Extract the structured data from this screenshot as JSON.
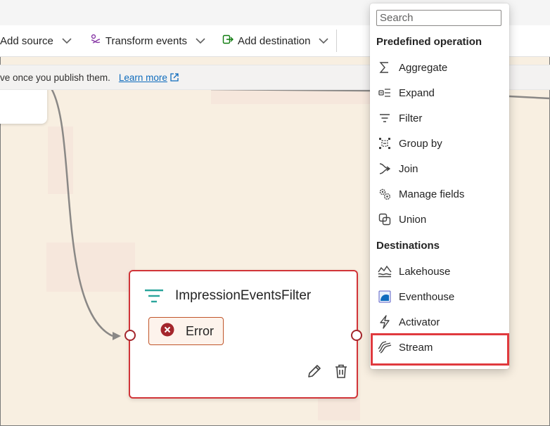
{
  "toolbar": {
    "add_source": "Add source",
    "transform_events": "Transform events",
    "add_destination": "Add destination"
  },
  "infobar": {
    "text": "ve once you publish them.",
    "learn_more": "Learn more"
  },
  "node": {
    "title": "ImpressionEventsFilter",
    "status": "Error"
  },
  "menu": {
    "search_placeholder": "Search",
    "sections": [
      {
        "title": "Predefined operation",
        "items": [
          {
            "label": "Aggregate",
            "icon": "sigma-icon"
          },
          {
            "label": "Expand",
            "icon": "expand-icon"
          },
          {
            "label": "Filter",
            "icon": "filter-icon"
          },
          {
            "label": "Group by",
            "icon": "group-by-icon"
          },
          {
            "label": "Join",
            "icon": "join-icon"
          },
          {
            "label": "Manage fields",
            "icon": "gears-icon"
          },
          {
            "label": "Union",
            "icon": "union-icon"
          }
        ]
      },
      {
        "title": "Destinations",
        "items": [
          {
            "label": "Lakehouse",
            "icon": "lakehouse-icon"
          },
          {
            "label": "Eventhouse",
            "icon": "eventhouse-icon"
          },
          {
            "label": "Activator",
            "icon": "lightning-icon"
          },
          {
            "label": "Stream",
            "icon": "stream-icon"
          }
        ]
      }
    ]
  },
  "colors": {
    "canvas": "#f8efe1",
    "error": "#d13438",
    "highlight": "#e03a3e",
    "link": "#0f6cbd",
    "filter_icon": "#2aa59b"
  }
}
